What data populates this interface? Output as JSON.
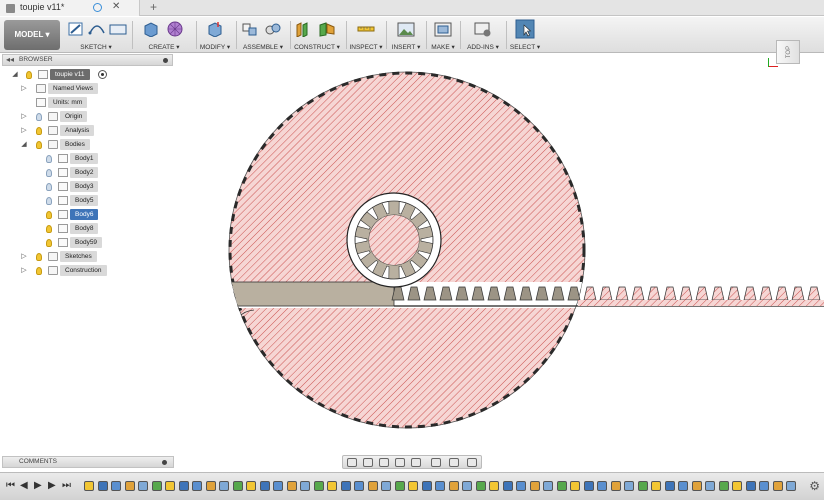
{
  "tab": {
    "title": "toupie v11*"
  },
  "toolbar": {
    "workspace": "MODEL ▾",
    "groups": {
      "sketch": "SKETCH ▾",
      "create": "CREATE ▾",
      "modify": "MODIFY ▾",
      "assemble": "ASSEMBLE ▾",
      "construct": "CONSTRUCT ▾",
      "inspect": "INSPECT ▾",
      "insert": "INSERT ▾",
      "make": "MAKE ▾",
      "addins": "ADD-INS ▾",
      "select": "SELECT ▾"
    }
  },
  "viewcube": {
    "face": "TOP"
  },
  "browser": {
    "title": "BROWSER",
    "root": "toupie v11",
    "items": {
      "named_views": "Named Views",
      "units": "Units: mm",
      "origin": "Origin",
      "analysis": "Analysis",
      "bodies": "Bodies",
      "body1": "Body1",
      "body2": "Body2",
      "body3": "Body3",
      "body5": "Body5",
      "body6": "Body6",
      "body8": "Body8",
      "body59": "Body59",
      "sketches": "Sketches",
      "construction": "Construction"
    }
  },
  "comments": {
    "title": "COMMENTS"
  },
  "colors": {
    "section_fill": "#f6d6d4",
    "hatch": "#c0302e",
    "rack_fill": "#bdb3a3",
    "selection": "#3e74b8"
  },
  "icons": {
    "timeline": [
      "skip-start-icon",
      "step-back-icon",
      "play-icon",
      "step-forward-icon",
      "skip-end-icon",
      "timeline-settings-icon"
    ],
    "navbar": [
      "orbit-icon",
      "look-at-icon",
      "pan-icon",
      "zoom-icon",
      "fit-icon",
      "display-settings-icon",
      "grid-settings-icon",
      "viewports-icon"
    ]
  }
}
